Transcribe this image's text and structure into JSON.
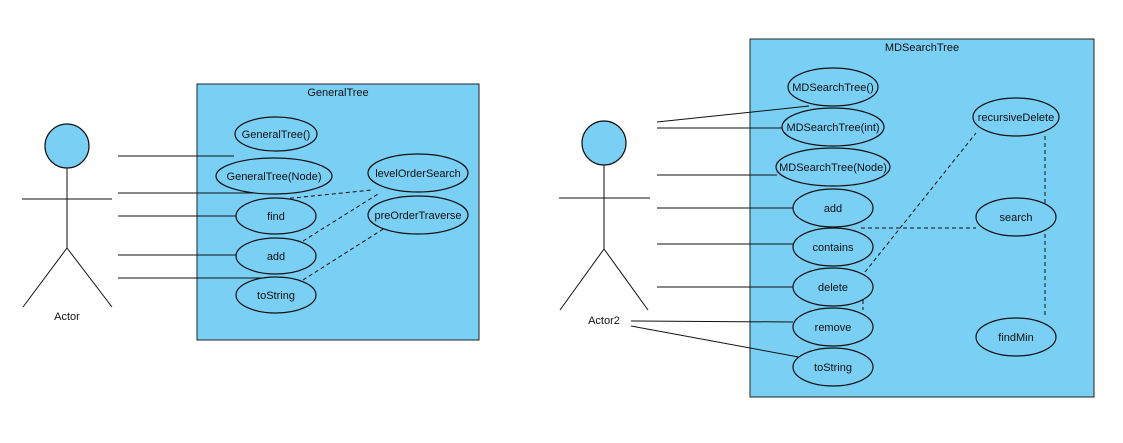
{
  "left_system": {
    "title": "GeneralTree",
    "actor": "Actor",
    "use_cases": {
      "ctor": "GeneralTree()",
      "ctor_node": "GeneralTree(Node)",
      "find": "find",
      "add": "add",
      "tostring": "toString",
      "level_order_search": "levelOrderSearch",
      "pre_order_traverse": "preOrderTraverse"
    }
  },
  "right_system": {
    "title": "MDSearchTree",
    "actor": "Actor2",
    "use_cases": {
      "ctor": "MDSearchTree()",
      "ctor_int": "MDSearchTree(int)",
      "ctor_node": "MDSearchTree(Node)",
      "add": "add",
      "contains": "contains",
      "delete": "delete",
      "remove": "remove",
      "tostring": "toString",
      "recursive_delete": "recursiveDelete",
      "search": "search",
      "find_min": "findMin"
    }
  },
  "colors": {
    "fill": "#7ACFF5",
    "stroke": "#111111"
  }
}
